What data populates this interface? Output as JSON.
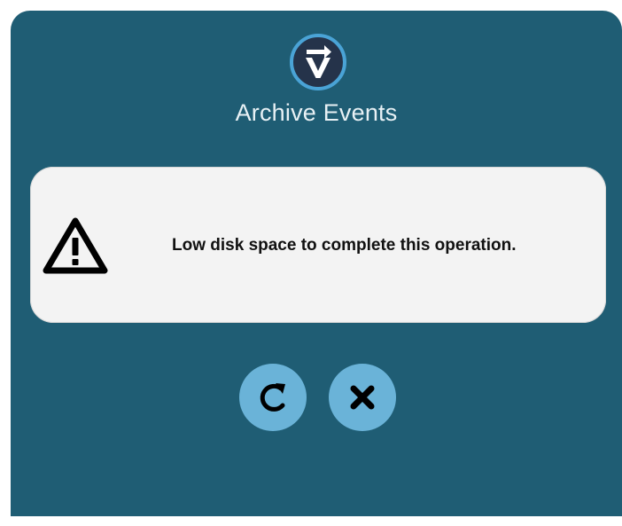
{
  "dialog": {
    "title": "Archive Events",
    "logo_icon": "v-arrow-logo-icon",
    "accent_color": "#1f5d74",
    "panel_color": "#f3f3f3"
  },
  "message": {
    "icon": "warning-icon",
    "text": "Low disk space to complete this operation."
  },
  "actions": {
    "retry_icon": "retry-icon",
    "cancel_icon": "close-icon",
    "button_color": "#6ab3d8"
  }
}
